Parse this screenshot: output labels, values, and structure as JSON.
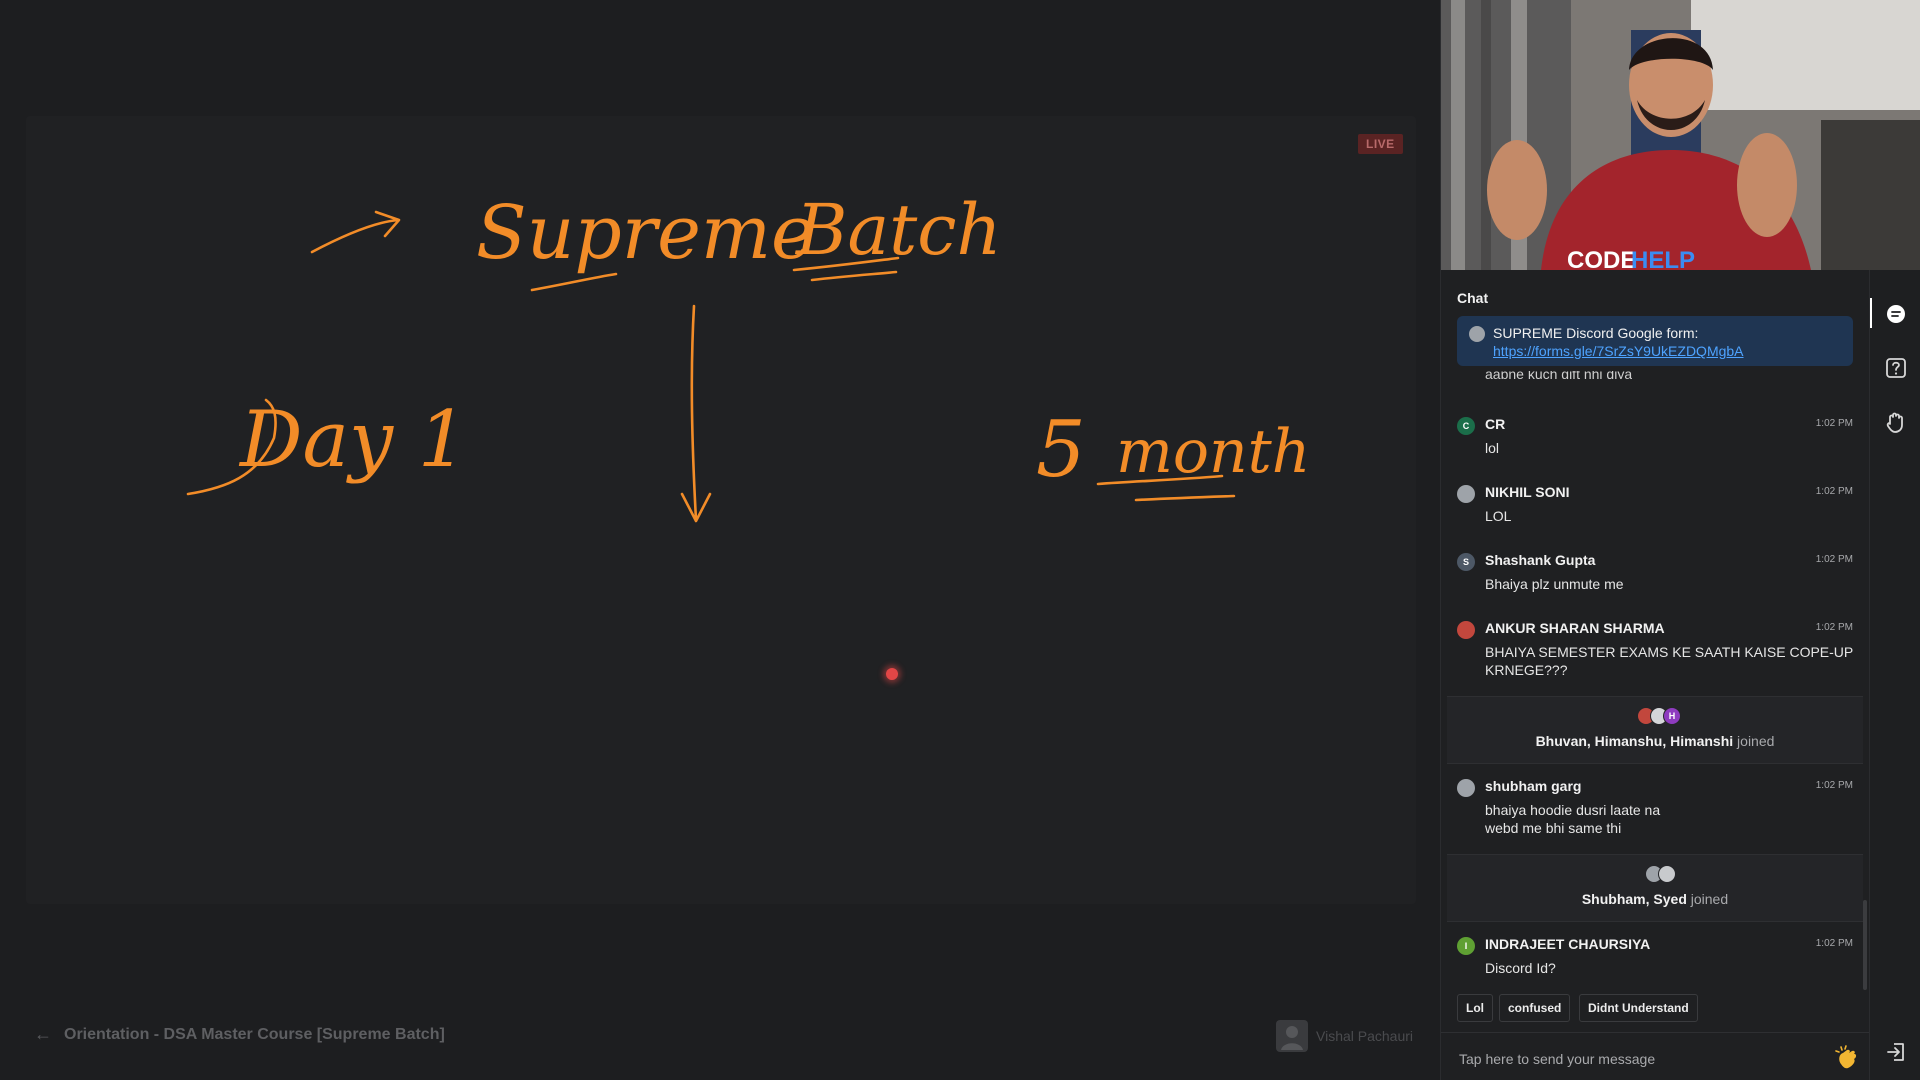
{
  "stage": {
    "live_label": "LIVE",
    "session_title": "Orientation - DSA Master Course [Supreme Batch]",
    "host_name": "Vishal Pachauri",
    "board_text": {
      "title_word1": "Supreme",
      "title_word2": "Batch",
      "left_note": "Day 1",
      "right_note_num": "5",
      "right_note_word": "month"
    }
  },
  "chat": {
    "header": "Chat",
    "pinned": {
      "text": "SUPREME Discord Google form:",
      "link": "https://forms.gle/7SrZsY9UkEZDQMgbA"
    },
    "cut_text": "aapne kuch gift nhi diya",
    "messages": [
      {
        "name": "CR",
        "time": "1:02 PM",
        "text": "lol",
        "initial": "C",
        "color": "#1b6e4a"
      },
      {
        "name": "NIKHIL SONI",
        "time": "1:02 PM",
        "text": "LOL",
        "initial": "",
        "color": "#9ea3a9"
      },
      {
        "name": "Shashank Gupta",
        "time": "1:02 PM",
        "text": "Bhaiya plz unmute me",
        "initial": "S",
        "color": "#4d5866"
      },
      {
        "name": "ANKUR SHARAN SHARMA",
        "time": "1:02 PM",
        "text": "BHAIYA SEMESTER EXAMS KE SAATH KAISE COPE-UP KRNEGE???",
        "initial": "",
        "color": "#c2473d"
      }
    ],
    "join1": {
      "names": "Bhuvan, Himanshu, Himanshi",
      "suffix": "joined",
      "h_initial": "H"
    },
    "messages2": [
      {
        "name": "shubham garg",
        "time": "1:02 PM",
        "text_line1": "bhaiya hoodie dusri laate na",
        "text_line2": "webd me bhi same thi",
        "color": "#9ea3a9"
      }
    ],
    "join2": {
      "names": "Shubham, Syed",
      "suffix": "joined"
    },
    "messages3": [
      {
        "name": "INDRAJEET CHAURSIYA",
        "time": "1:02 PM",
        "text": "Discord Id?",
        "initial": "I",
        "color": "#5fa033"
      }
    ],
    "quick_replies": [
      "Lol",
      "confused",
      "Didnt Understand"
    ],
    "input_placeholder": "Tap here to send your message"
  },
  "icons": [
    "arrow-left-icon",
    "chat-icon",
    "question-icon",
    "raise-hand-icon",
    "exit-icon",
    "clap-icon",
    "user-avatar-icon"
  ],
  "colors": {
    "ink": "#f28c28",
    "pinned_bg": "#1f3552",
    "link": "#4ea3ff",
    "live_bg": "#5a2323"
  }
}
